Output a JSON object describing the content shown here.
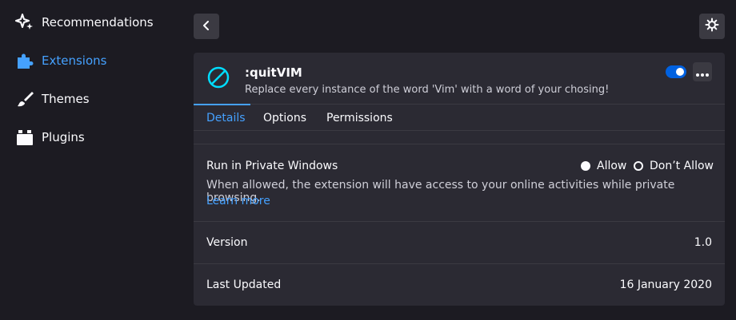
{
  "sidebar": {
    "items": [
      {
        "label": "Recommendations",
        "icon": "sparkle-icon"
      },
      {
        "label": "Extensions",
        "icon": "puzzle-icon",
        "active": true
      },
      {
        "label": "Themes",
        "icon": "brush-icon"
      },
      {
        "label": "Plugins",
        "icon": "plugin-icon"
      }
    ]
  },
  "addon": {
    "name": ":quitVIM",
    "description": "Replace every instance of the word 'Vim' with a word of your chosing!",
    "enabled": true
  },
  "tabs": [
    {
      "label": "Details",
      "active": true
    },
    {
      "label": "Options"
    },
    {
      "label": "Permissions"
    }
  ],
  "private": {
    "label": "Run in Private Windows",
    "allow": "Allow",
    "dont_allow": "Don’t Allow",
    "selected": "Allow",
    "description": "When allowed, the extension will have access to your online activities while private browsing.",
    "learn_more": "Learn more"
  },
  "version": {
    "label": "Version",
    "value": "1.0"
  },
  "last_updated": {
    "label": "Last Updated",
    "value": "16 January 2020"
  },
  "colors": {
    "accent": "#45a1ff",
    "toggle": "#0061e0",
    "card": "#2b2a33",
    "background": "#1c1b22"
  }
}
